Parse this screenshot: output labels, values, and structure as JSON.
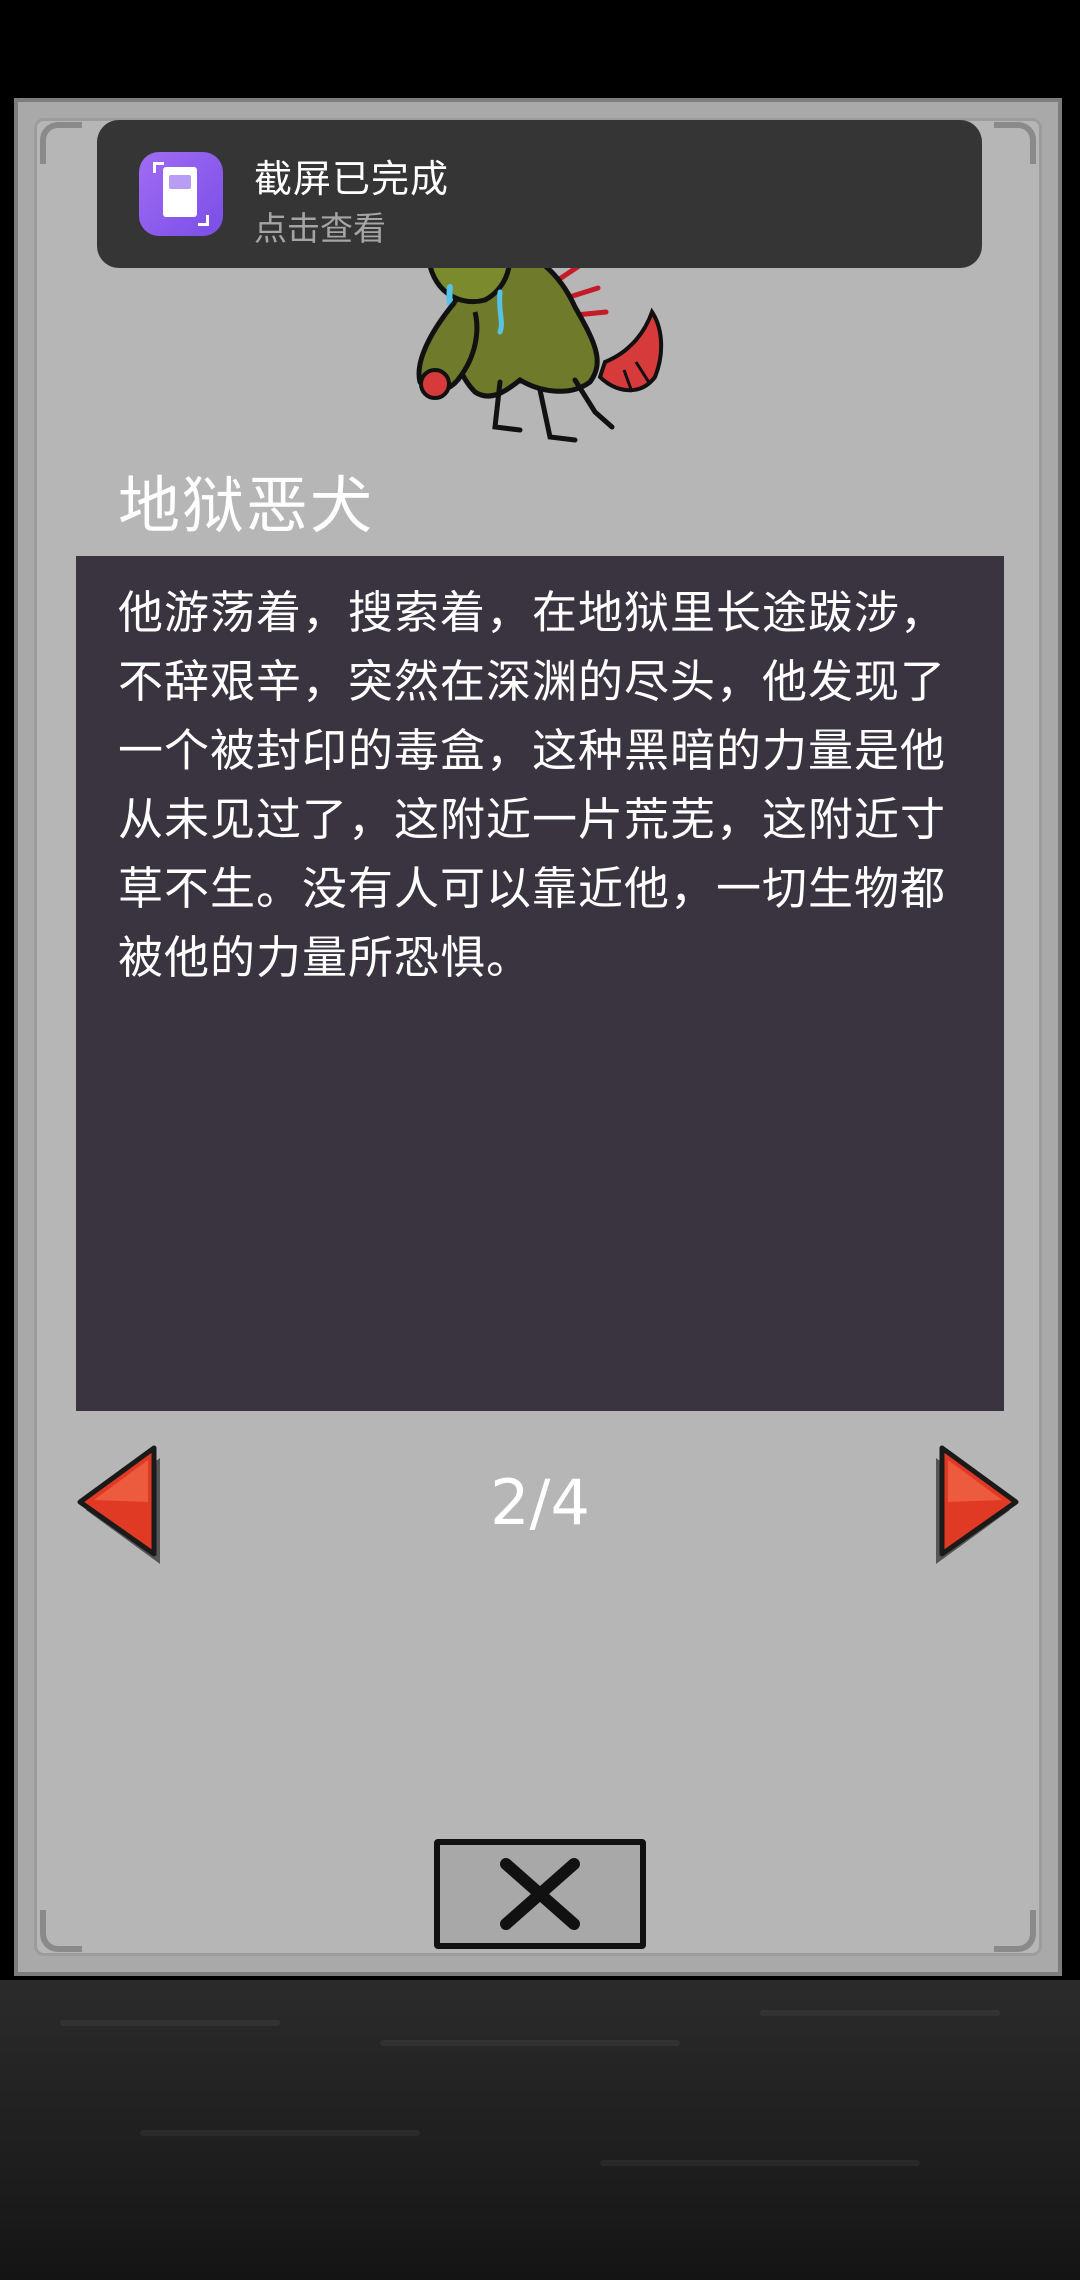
{
  "notification": {
    "title": "截屏已完成",
    "subtitle": "点击查看",
    "icon": "screenshot-app-icon"
  },
  "monster": {
    "name": "地狱恶犬",
    "image": "hell-hound-sprite",
    "description": "他游荡着，搜索着，在地狱里长途跋涉，不辞艰辛，突然在深渊的尽头，他发现了一个被封印的毒盒，这种黑暗的力量是他从未见过了，这附近一片荒芜，这附近寸草不生。没有人可以靠近他，一切生物都被他的力量所恐惧。"
  },
  "pagination": {
    "label": "2/4",
    "current": 2,
    "total": 4,
    "prev_icon": "left-arrow-icon",
    "next_icon": "right-arrow-icon"
  },
  "close": {
    "icon": "close-x-icon"
  },
  "colors": {
    "card": "#b6b6b6",
    "panel": "#3a3440",
    "arrow": "#e03a24",
    "toast": "#353535",
    "toast_icon": "#8f5cf0"
  }
}
